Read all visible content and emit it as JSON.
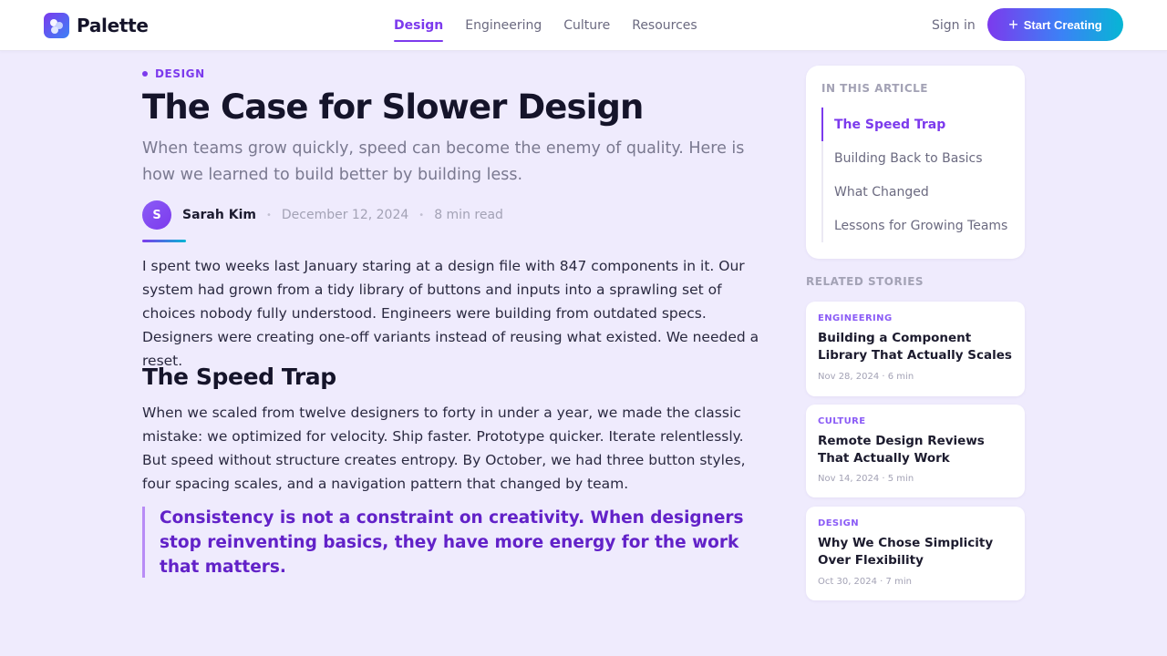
{
  "header": {
    "brand": "Palette",
    "nav": [
      {
        "label": "Design",
        "active": true
      },
      {
        "label": "Engineering",
        "active": false
      },
      {
        "label": "Culture",
        "active": false
      },
      {
        "label": "Resources",
        "active": false
      }
    ],
    "sign_in": "Sign in",
    "cta_icon": "plus-icon",
    "cta_label": "Start Creating"
  },
  "article": {
    "category": "DESIGN",
    "title": "The Case for Slower Design",
    "subtitle": "When teams grow quickly, speed can become the enemy of quality. Here is how we learned to build better by building less.",
    "author_initial": "S",
    "author": "Sarah Kim",
    "date": "December 12, 2024",
    "read_time": "8 min read",
    "paragraph1": "I spent two weeks last January staring at a design file with 847 components in it. Our system had grown from a tidy library of buttons and inputs into a sprawling set of choices nobody fully understood. Engineers were building from outdated specs. Designers were creating one-off variants instead of reusing what existed. We needed a reset.",
    "heading": "The Speed Trap",
    "paragraph2": "When we scaled from twelve designers to forty in under a year, we made the classic mistake: we optimized for velocity. Ship faster. Prototype quicker. Iterate relentlessly. But speed without structure creates entropy. By October, we had three button styles, four spacing scales, and a navigation pattern that changed by team.",
    "quote": "Consistency is not a constraint on creativity. When designers stop reinventing basics, they have more energy for the work that matters."
  },
  "toc": {
    "label": "IN THIS ARTICLE",
    "items": [
      {
        "label": "The Speed Trap",
        "active": true
      },
      {
        "label": "Building Back to Basics",
        "active": false
      },
      {
        "label": "What Changed",
        "active": false
      },
      {
        "label": "Lessons for Growing Teams",
        "active": false
      }
    ]
  },
  "related": {
    "label": "RELATED STORIES",
    "stories": [
      {
        "category": "ENGINEERING",
        "title": "Building a Component Library That Actually Scales",
        "meta": "Nov 28, 2024 · 6 min"
      },
      {
        "category": "CULTURE",
        "title": "Remote Design Reviews That Actually Work",
        "meta": "Nov 14, 2024 · 5 min"
      },
      {
        "category": "DESIGN",
        "title": "Why We Chose Simplicity Over Flexibility",
        "meta": "Oct 30, 2024 · 7 min"
      }
    ]
  },
  "colors": {
    "accent": "#7c3aed",
    "background": "#efebfd",
    "gradient_end": "#06b6d4"
  }
}
